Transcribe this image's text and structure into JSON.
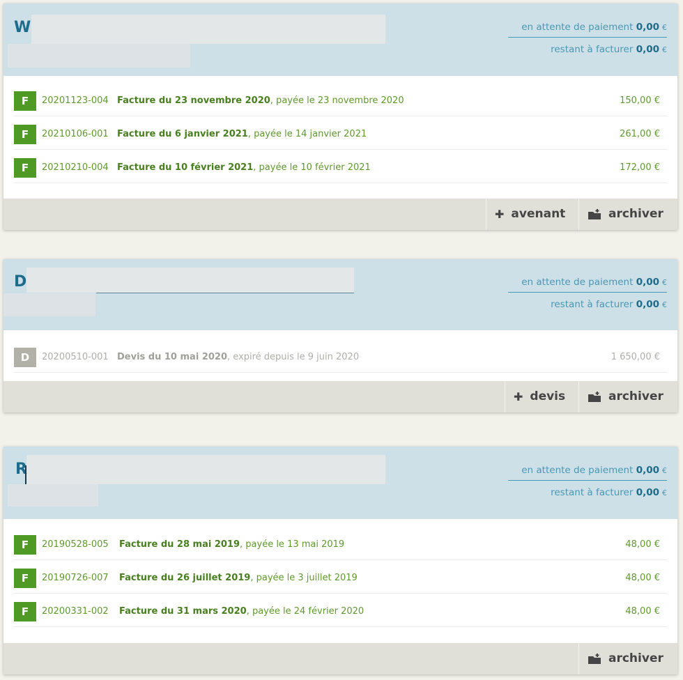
{
  "labels": {
    "pending": "en attente de paiement",
    "to_invoice": "restant à facturer",
    "currency": "€",
    "archive": "archiver"
  },
  "clients": [
    {
      "initial": "W",
      "pending_amount": "0,00",
      "to_invoice_amount": "0,00",
      "add_button": "avenant",
      "documents": [
        {
          "badge": "F",
          "number": "20201123-004",
          "title": "Facture du 23 novembre 2020",
          "status": ", payée le 23 novembre 2020",
          "amount": "150,00 €"
        },
        {
          "badge": "F",
          "number": "20210106-001",
          "title": "Facture du 6 janvier 2021",
          "status": ", payée le 14 janvier 2021",
          "amount": "261,00 €"
        },
        {
          "badge": "F",
          "number": "20210210-004",
          "title": "Facture du 10 février 2021",
          "status": ", payée le 10 février 2021",
          "amount": "172,00 €"
        }
      ]
    },
    {
      "initial": "D",
      "pending_amount": "0,00",
      "to_invoice_amount": "0,00",
      "add_button": "devis",
      "documents": [
        {
          "badge": "D",
          "number": "20200510-001",
          "title": "Devis du 10 mai 2020",
          "status": ", expiré depuis le 9 juin 2020",
          "amount": "1 650,00 €"
        }
      ]
    },
    {
      "initial": "R",
      "pending_amount": "0,00",
      "to_invoice_amount": "0,00",
      "documents": [
        {
          "badge": "F",
          "number": "20190528-005",
          "title": "Facture du 28 mai 2019",
          "status": ", payée le 13 mai 2019",
          "amount": "48,00 €"
        },
        {
          "badge": "F",
          "number": "20190726-007",
          "title": "Facture du 26 juillet 2019",
          "status": ", payée le 3 juillet 2019",
          "amount": "48,00 €"
        },
        {
          "badge": "F",
          "number": "20200331-002",
          "title": "Facture du 31 mars 2020",
          "status": ", payée le 24 février 2020",
          "amount": "48,00 €"
        }
      ]
    }
  ],
  "colors": {
    "header_bg": "#cde0e7",
    "accent_blue": "#1d6c8c",
    "paid_green": "#4f9a24",
    "draft_gray": "#b2b1a8",
    "footer_bg": "#e0e0d8"
  },
  "icons": {
    "add": "plus-icon",
    "archive": "archive-folder-icon"
  }
}
